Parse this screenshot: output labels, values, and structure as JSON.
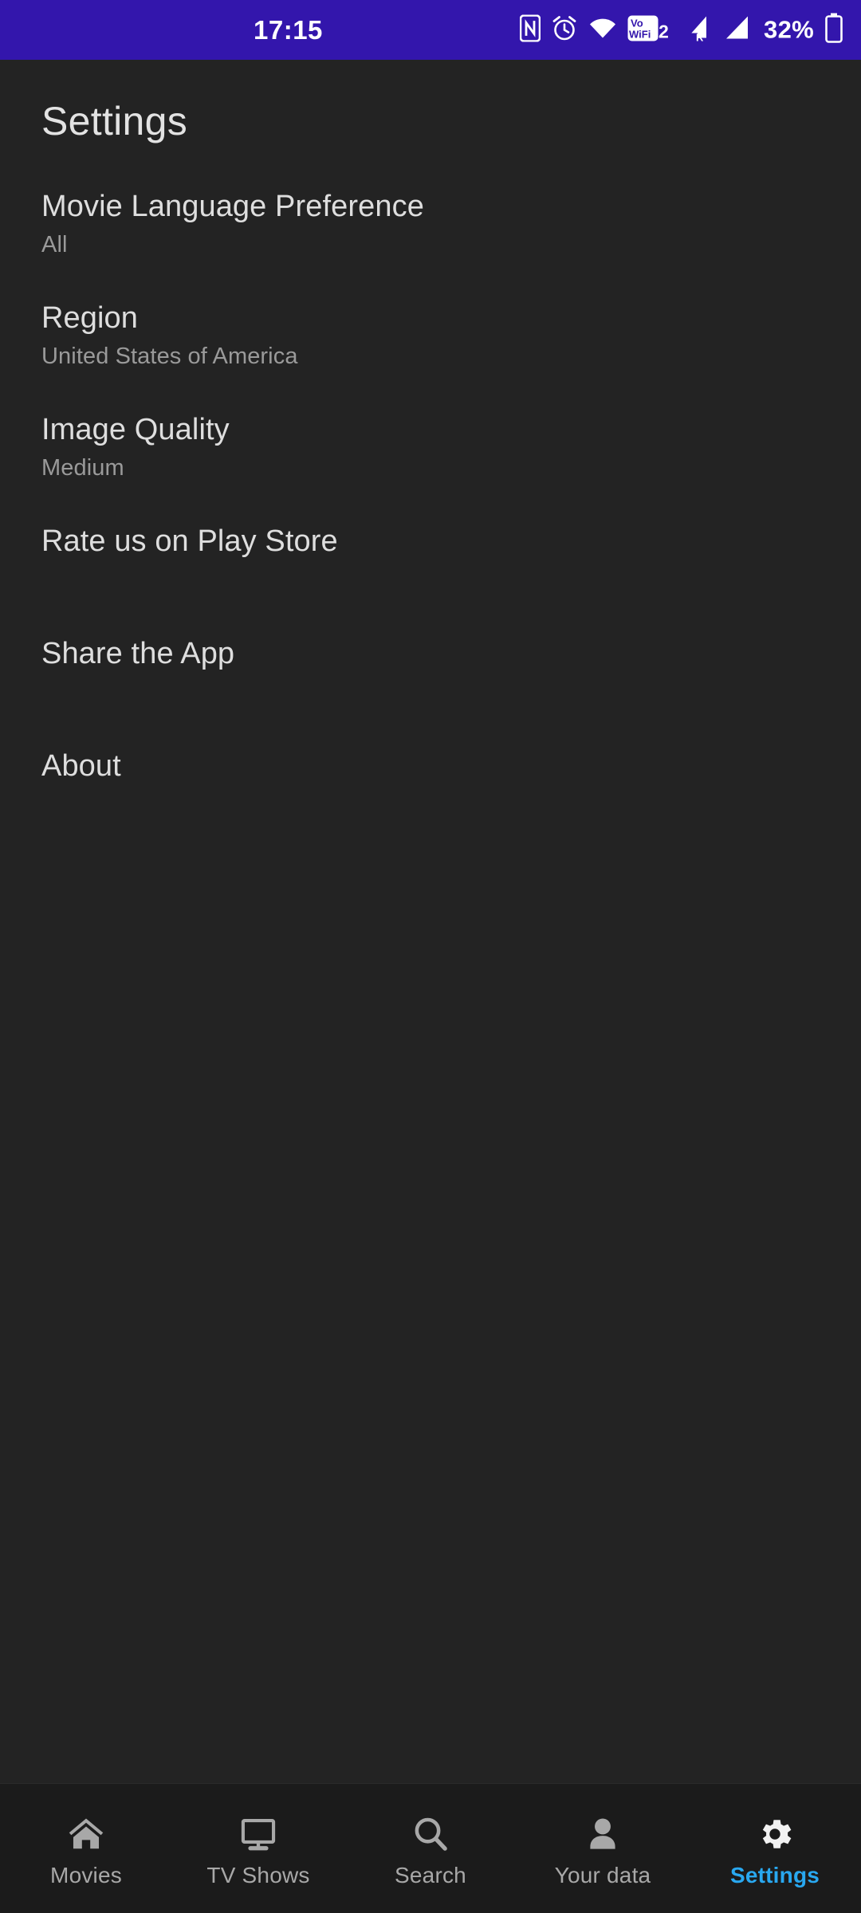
{
  "status_bar": {
    "background_color": "#3316ac",
    "clock": "17:15",
    "battery_percent": "32%",
    "icons": [
      {
        "name": "nfc-icon",
        "label": "N"
      },
      {
        "name": "alarm-clock-icon",
        "label": "alarm"
      },
      {
        "name": "wifi-icon",
        "label": "wifi"
      },
      {
        "name": "vowifi2-icon",
        "label": "VoWiFi2"
      },
      {
        "name": "signal-roaming-icon",
        "label": "R"
      },
      {
        "name": "signal-bars-icon",
        "label": "signal"
      },
      {
        "name": "battery-icon",
        "label": "battery"
      }
    ]
  },
  "header": {
    "title": "Settings"
  },
  "settings": {
    "items": [
      {
        "id": "movie-language-preference",
        "title": "Movie Language Preference",
        "value": "All"
      },
      {
        "id": "region",
        "title": "Region",
        "value": "United States of America"
      },
      {
        "id": "image-quality",
        "title": "Image Quality",
        "value": "Medium"
      },
      {
        "id": "rate-us-on-play-store",
        "title": "Rate us on Play Store",
        "value": ""
      },
      {
        "id": "share-the-app",
        "title": "Share the App",
        "value": ""
      },
      {
        "id": "about",
        "title": "About",
        "value": ""
      }
    ]
  },
  "bottom_nav": {
    "active_color": "#29a8f0",
    "inactive_color": "#a8a8a8",
    "items": [
      {
        "id": "movies",
        "label": "Movies",
        "icon": "home-icon",
        "active": false
      },
      {
        "id": "tv-shows",
        "label": "TV Shows",
        "icon": "tv-monitor-icon",
        "active": false
      },
      {
        "id": "search",
        "label": "Search",
        "icon": "search-icon",
        "active": false
      },
      {
        "id": "your-data",
        "label": "Your data",
        "icon": "person-icon",
        "active": false
      },
      {
        "id": "settings",
        "label": "Settings",
        "icon": "gear-icon",
        "active": true
      }
    ]
  }
}
